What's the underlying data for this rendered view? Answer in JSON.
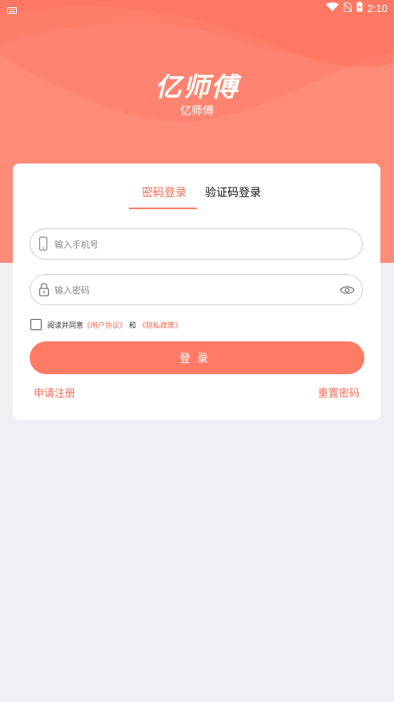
{
  "status_bar": {
    "time": "2:10",
    "icons": [
      "keyboard-icon",
      "wifi-icon",
      "no-sim-icon",
      "battery-charging-icon"
    ]
  },
  "brand": {
    "logo_text": "亿师傅",
    "subtitle": "亿师傅"
  },
  "login": {
    "tabs": [
      {
        "label": "密码登录",
        "active": true
      },
      {
        "label": "验证码登录",
        "active": false
      }
    ],
    "phone_input": {
      "placeholder": "输入手机号",
      "value": "",
      "icon": "phone-icon"
    },
    "password_input": {
      "placeholder": "输入密码",
      "value": "",
      "icon": "lock-icon",
      "toggle_icon": "eye-icon"
    },
    "agreement": {
      "checked": false,
      "prefix": "阅读并同意",
      "user_agreement": "《用户协议》",
      "and_text": "和",
      "privacy_policy": "《隐私政策》"
    },
    "login_button": "登录",
    "register_link": "申请注册",
    "reset_link": "重置密码"
  },
  "colors": {
    "header": "#ff8b79",
    "accent": "#f26b55",
    "button": "#ff7b66",
    "page_bg": "#f0eff4"
  }
}
